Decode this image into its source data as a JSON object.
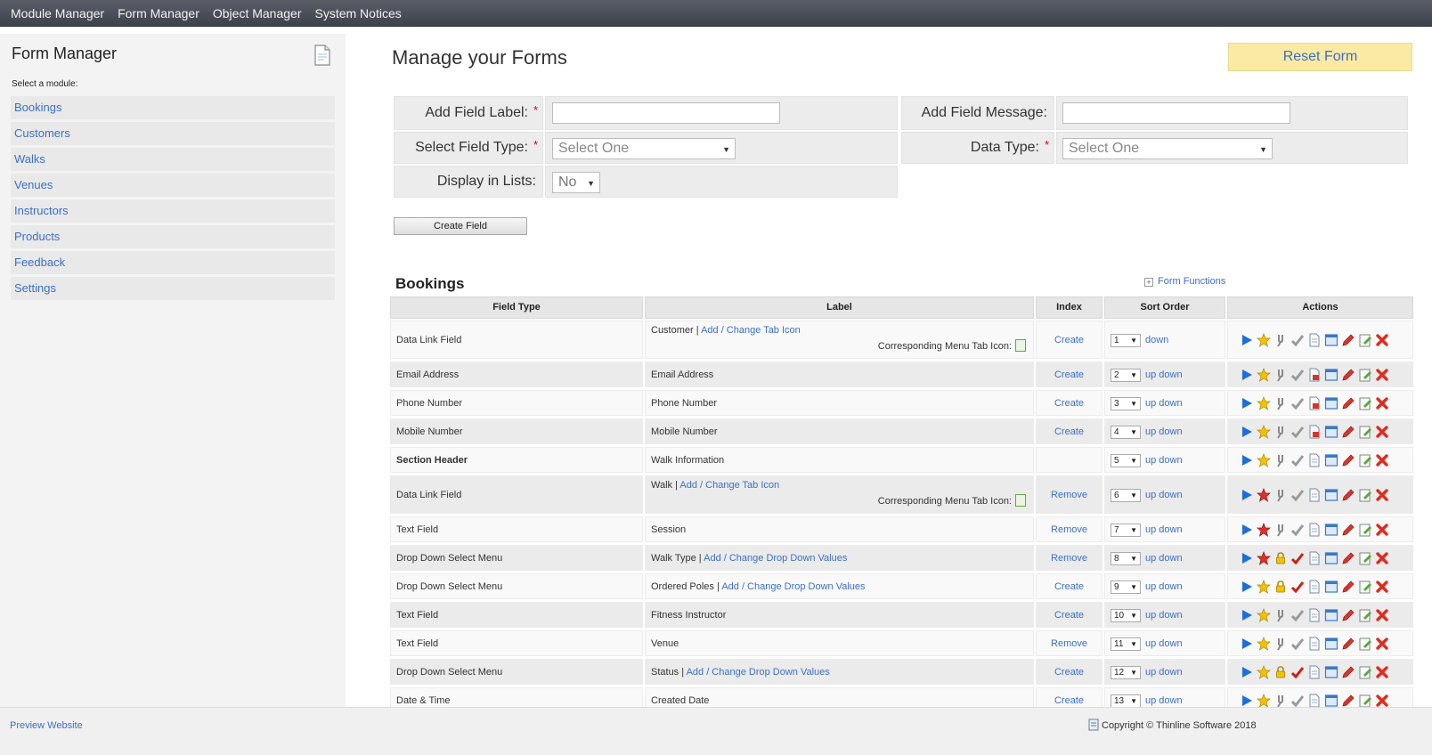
{
  "nav": {
    "items": [
      "Module Manager",
      "Form Manager",
      "Object Manager",
      "System Notices"
    ]
  },
  "sidebar": {
    "title": "Form Manager",
    "select_label": "Select a module:",
    "modules": [
      "Bookings",
      "Customers",
      "Walks",
      "Venues",
      "Instructors",
      "Products",
      "Feedback",
      "Settings"
    ]
  },
  "main": {
    "title": "Manage your Forms",
    "reset_label": "Reset Form"
  },
  "form": {
    "add_field_label": "Add Field Label:",
    "add_field_message": "Add Field Message:",
    "select_field_type": "Select Field Type:",
    "data_type": "Data Type:",
    "display_in_lists": "Display in Lists:",
    "field_type_value": "Select One",
    "data_type_value": "Select One",
    "display_value": "No",
    "required_mark": "*",
    "create_label": "Create Field"
  },
  "table": {
    "title": "Bookings",
    "functions_label": "Form Functions",
    "headers": [
      "Field Type",
      "Label",
      "Index",
      "Sort Order",
      "Actions"
    ],
    "corresponding_label": "Corresponding Menu Tab Icon:",
    "rows": [
      {
        "field_type": "Data Link Field",
        "label": "Customer",
        "link": "Add / Change Tab Icon",
        "corresponding": true,
        "index": "Create",
        "sort": "1",
        "updown": "down",
        "star": "gold",
        "lock": false
      },
      {
        "field_type": "Email Address",
        "label": "Email Address",
        "link": "",
        "corresponding": false,
        "index": "Create",
        "sort": "2",
        "updown": "up down",
        "star": "gold",
        "lock": false
      },
      {
        "field_type": "Phone Number",
        "label": "Phone Number",
        "link": "",
        "corresponding": false,
        "index": "Create",
        "sort": "3",
        "updown": "up down",
        "star": "gold",
        "lock": false
      },
      {
        "field_type": "Mobile Number",
        "label": "Mobile Number",
        "link": "",
        "corresponding": false,
        "index": "Create",
        "sort": "4",
        "updown": "up down",
        "star": "gold",
        "lock": false
      },
      {
        "field_type": "Section Header",
        "bold": true,
        "label": "Walk Information",
        "link": "",
        "corresponding": false,
        "index": "",
        "sort": "5",
        "updown": "up down",
        "star": "gold",
        "lock": false
      },
      {
        "field_type": "Data Link Field",
        "label": "Walk",
        "link": "Add / Change Tab Icon",
        "corresponding": true,
        "index": "Remove",
        "sort": "6",
        "updown": "up down",
        "star": "red",
        "lock": false
      },
      {
        "field_type": "Text Field",
        "label": "Session",
        "link": "",
        "corresponding": false,
        "index": "Remove",
        "sort": "7",
        "updown": "up down",
        "star": "red",
        "lock": false
      },
      {
        "field_type": "Drop Down Select Menu",
        "label": "Walk Type",
        "link": "Add / Change Drop Down Values",
        "corresponding": false,
        "index": "Remove",
        "sort": "8",
        "updown": "up down",
        "star": "red",
        "lock": true
      },
      {
        "field_type": "Drop Down Select Menu",
        "label": "Ordered Poles",
        "link": "Add / Change Drop Down Values",
        "corresponding": false,
        "index": "Create",
        "sort": "9",
        "updown": "up down",
        "star": "gold",
        "lock": true
      },
      {
        "field_type": "Text Field",
        "label": "Fitness Instructor",
        "link": "",
        "corresponding": false,
        "index": "Create",
        "sort": "10",
        "updown": "up down",
        "star": "gold",
        "lock": false
      },
      {
        "field_type": "Text Field",
        "label": "Venue",
        "link": "",
        "corresponding": false,
        "index": "Remove",
        "sort": "11",
        "updown": "up down",
        "star": "gold",
        "lock": false
      },
      {
        "field_type": "Drop Down Select Menu",
        "label": "Status",
        "link": "Add / Change Drop Down Values",
        "corresponding": false,
        "index": "Create",
        "sort": "12",
        "updown": "up down",
        "star": "gold",
        "lock": true
      },
      {
        "field_type": "Date & Time",
        "label": "Created Date",
        "link": "",
        "corresponding": false,
        "index": "Create",
        "sort": "13",
        "updown": "up down",
        "star": "gold",
        "lock": false
      }
    ]
  },
  "footer": {
    "preview": "Preview Website",
    "copyright": "Copyright © Thinline Software 2018"
  },
  "icons": [
    "play-icon",
    "star-icon",
    "tuning-fork-icon",
    "check-icon",
    "document-icon",
    "window-icon",
    "pencil-icon",
    "edit-icon",
    "delete-icon"
  ],
  "colors": {
    "link": "#3c6fc4",
    "reset_bg": "#fbeaa3",
    "nav_bg": "#4a4e58",
    "required": "#d40000"
  }
}
